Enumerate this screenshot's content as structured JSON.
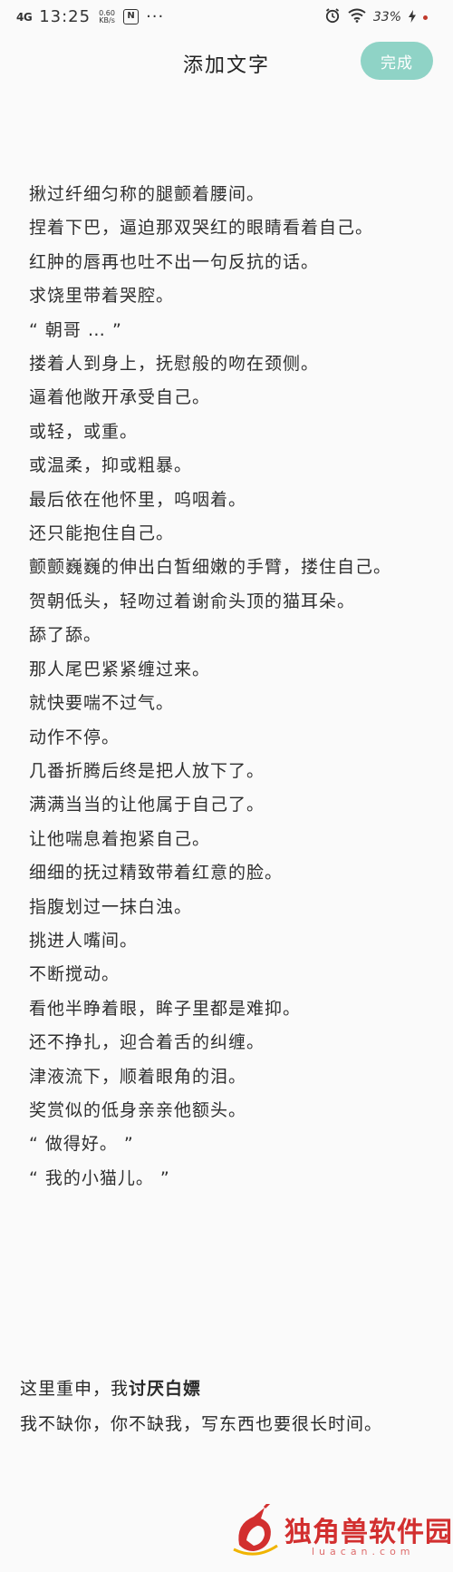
{
  "status": {
    "signal": "4G",
    "time": "13:25",
    "speed_value": "0.60",
    "speed_unit": "KB/s",
    "nfc": "N",
    "more": "···",
    "battery": "33%"
  },
  "header": {
    "title": "添加文字",
    "done_label": "完成"
  },
  "editor": {
    "lines": [
      "揪过纤细匀称的腿颤着腰间。",
      "捏着下巴，逼迫那双哭红的眼睛看着自己。",
      "红肿的唇再也吐不出一句反抗的话。",
      "求饶里带着哭腔。",
      "“ 朝哥 … ”",
      "搂着人到身上，抚慰般的吻在颈侧。",
      "逼着他敞开承受自己。",
      "或轻，或重。",
      "或温柔，抑或粗暴。",
      "最后依在他怀里，呜咽着。",
      "还只能抱住自己。",
      "颤颤巍巍的伸出白皙细嫩的手臂，搂住自己。",
      "贺朝低头，轻吻过着谢俞头顶的猫耳朵。",
      "舔了舔。",
      "那人尾巴紧紧缠过来。",
      "就快要喘不过气。",
      "动作不停。",
      "几番折腾后终是把人放下了。",
      "满满当当的让他属于自己了。",
      "让他喘息着抱紧自己。",
      "细细的抚过精致带着红意的脸。",
      "指腹划过一抹白浊。",
      "挑进人嘴间。",
      "不断搅动。",
      "看他半睁着眼，眸子里都是难抑。",
      "还不挣扎，迎合着舌的纠缠。",
      "津液流下，顺着眼角的泪。",
      "奖赏似的低身亲亲他额头。",
      "“ 做得好。 ”",
      "“ 我的小猫儿。 ”"
    ]
  },
  "note": {
    "line1_prefix": "这里重申，我",
    "line1_strong": "讨厌白嫖",
    "line2": "我不缺你，你不缺我，写东西也要很长时间。"
  },
  "watermark": {
    "text": "独角兽软件园",
    "url": "luacan.com"
  },
  "colors": {
    "accent_button": "#8fd3c6",
    "watermark_red": "#d22f2f"
  }
}
